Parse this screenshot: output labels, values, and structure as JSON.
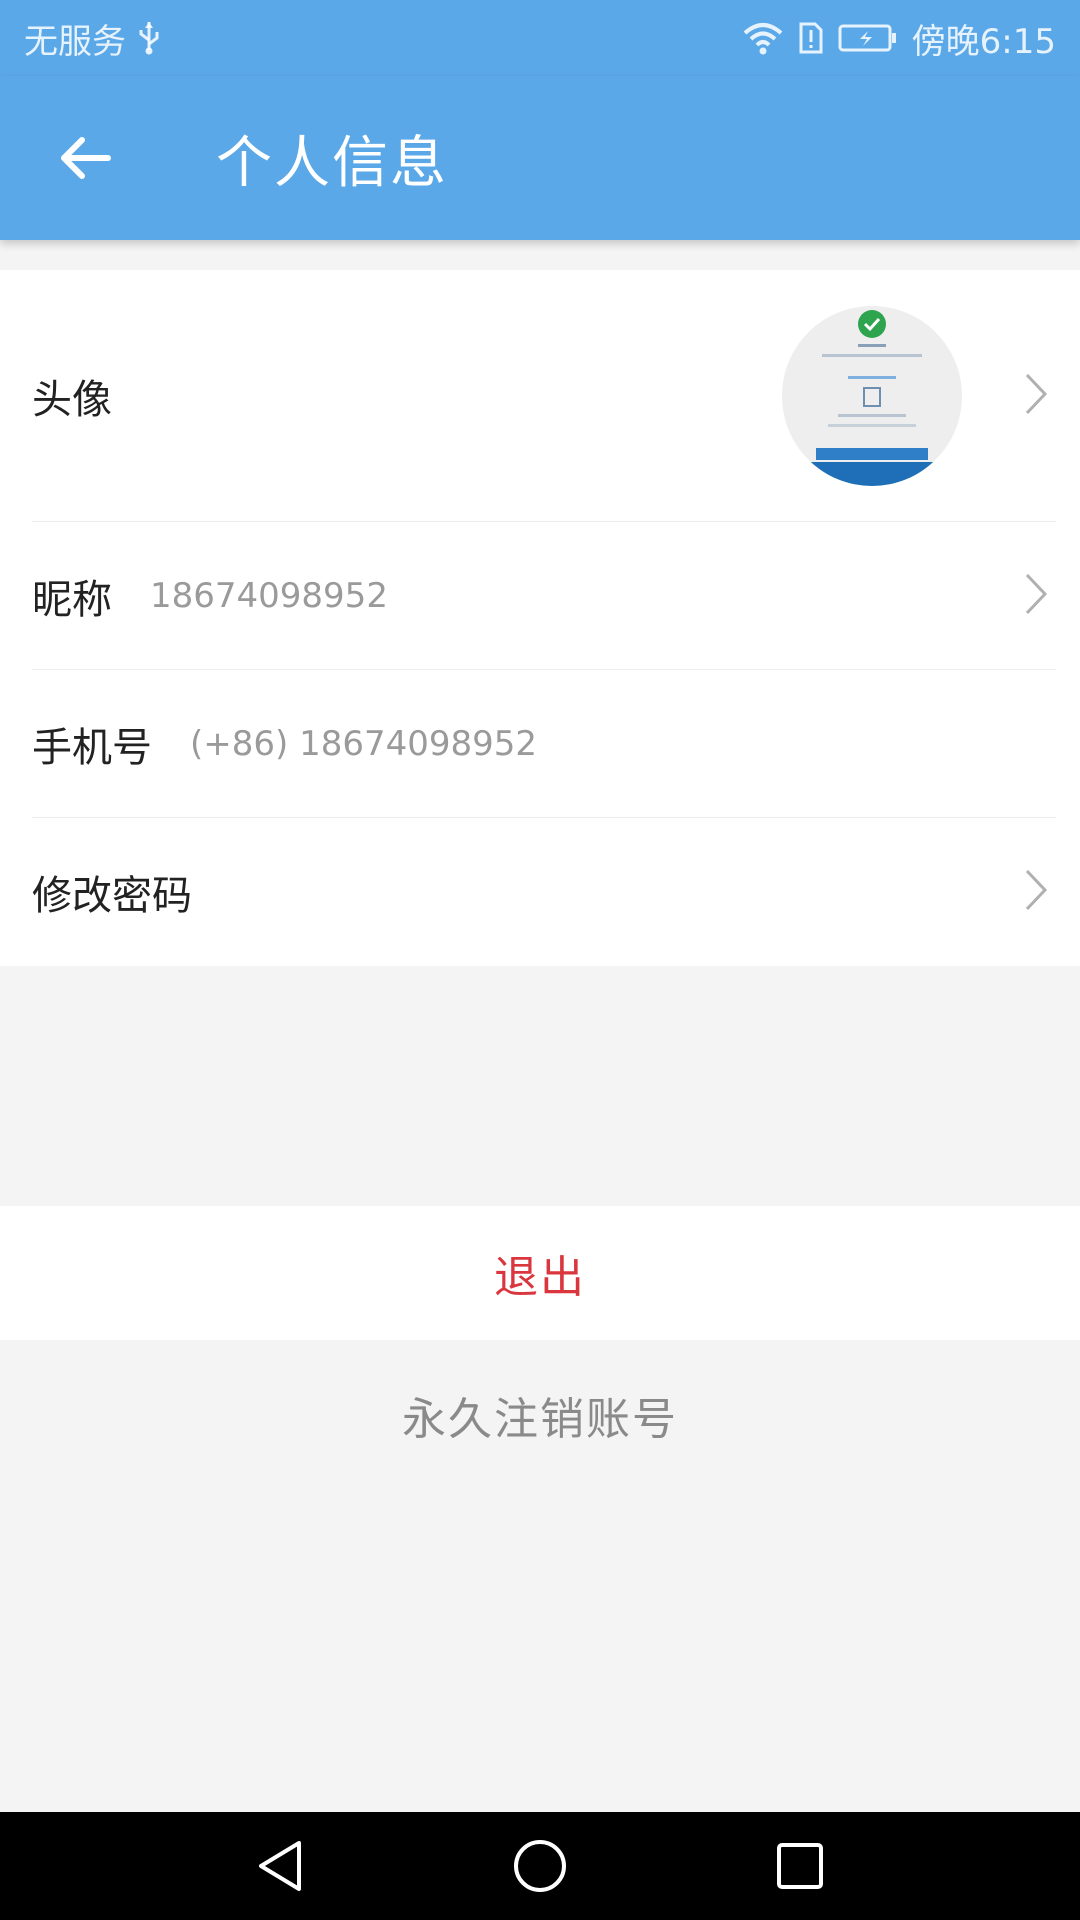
{
  "status_bar": {
    "carrier": "无服务",
    "time": "傍晚6:15",
    "icons": [
      "usb-icon",
      "wifi-icon",
      "sim-alert-icon",
      "battery-charging-icon"
    ]
  },
  "app_bar": {
    "title": "个人信息",
    "back_icon": "arrow-left-icon"
  },
  "profile": {
    "rows": [
      {
        "label": "头像",
        "value": "",
        "has_chevron": true
      },
      {
        "label": "昵称",
        "value": "18674098952",
        "has_chevron": true
      },
      {
        "label": "手机号",
        "value": "(+86) 18674098952",
        "has_chevron": false
      },
      {
        "label": "修改密码",
        "value": "",
        "has_chevron": true
      }
    ]
  },
  "actions": {
    "logout": "退出",
    "delete_account": "永久注销账号"
  },
  "colors": {
    "primary": "#5ba8e9",
    "logout_text": "#d9363e",
    "background": "#f4f4f4"
  },
  "nav_bar": {
    "icons": [
      "back-triangle-icon",
      "home-circle-icon",
      "recents-square-icon"
    ]
  }
}
